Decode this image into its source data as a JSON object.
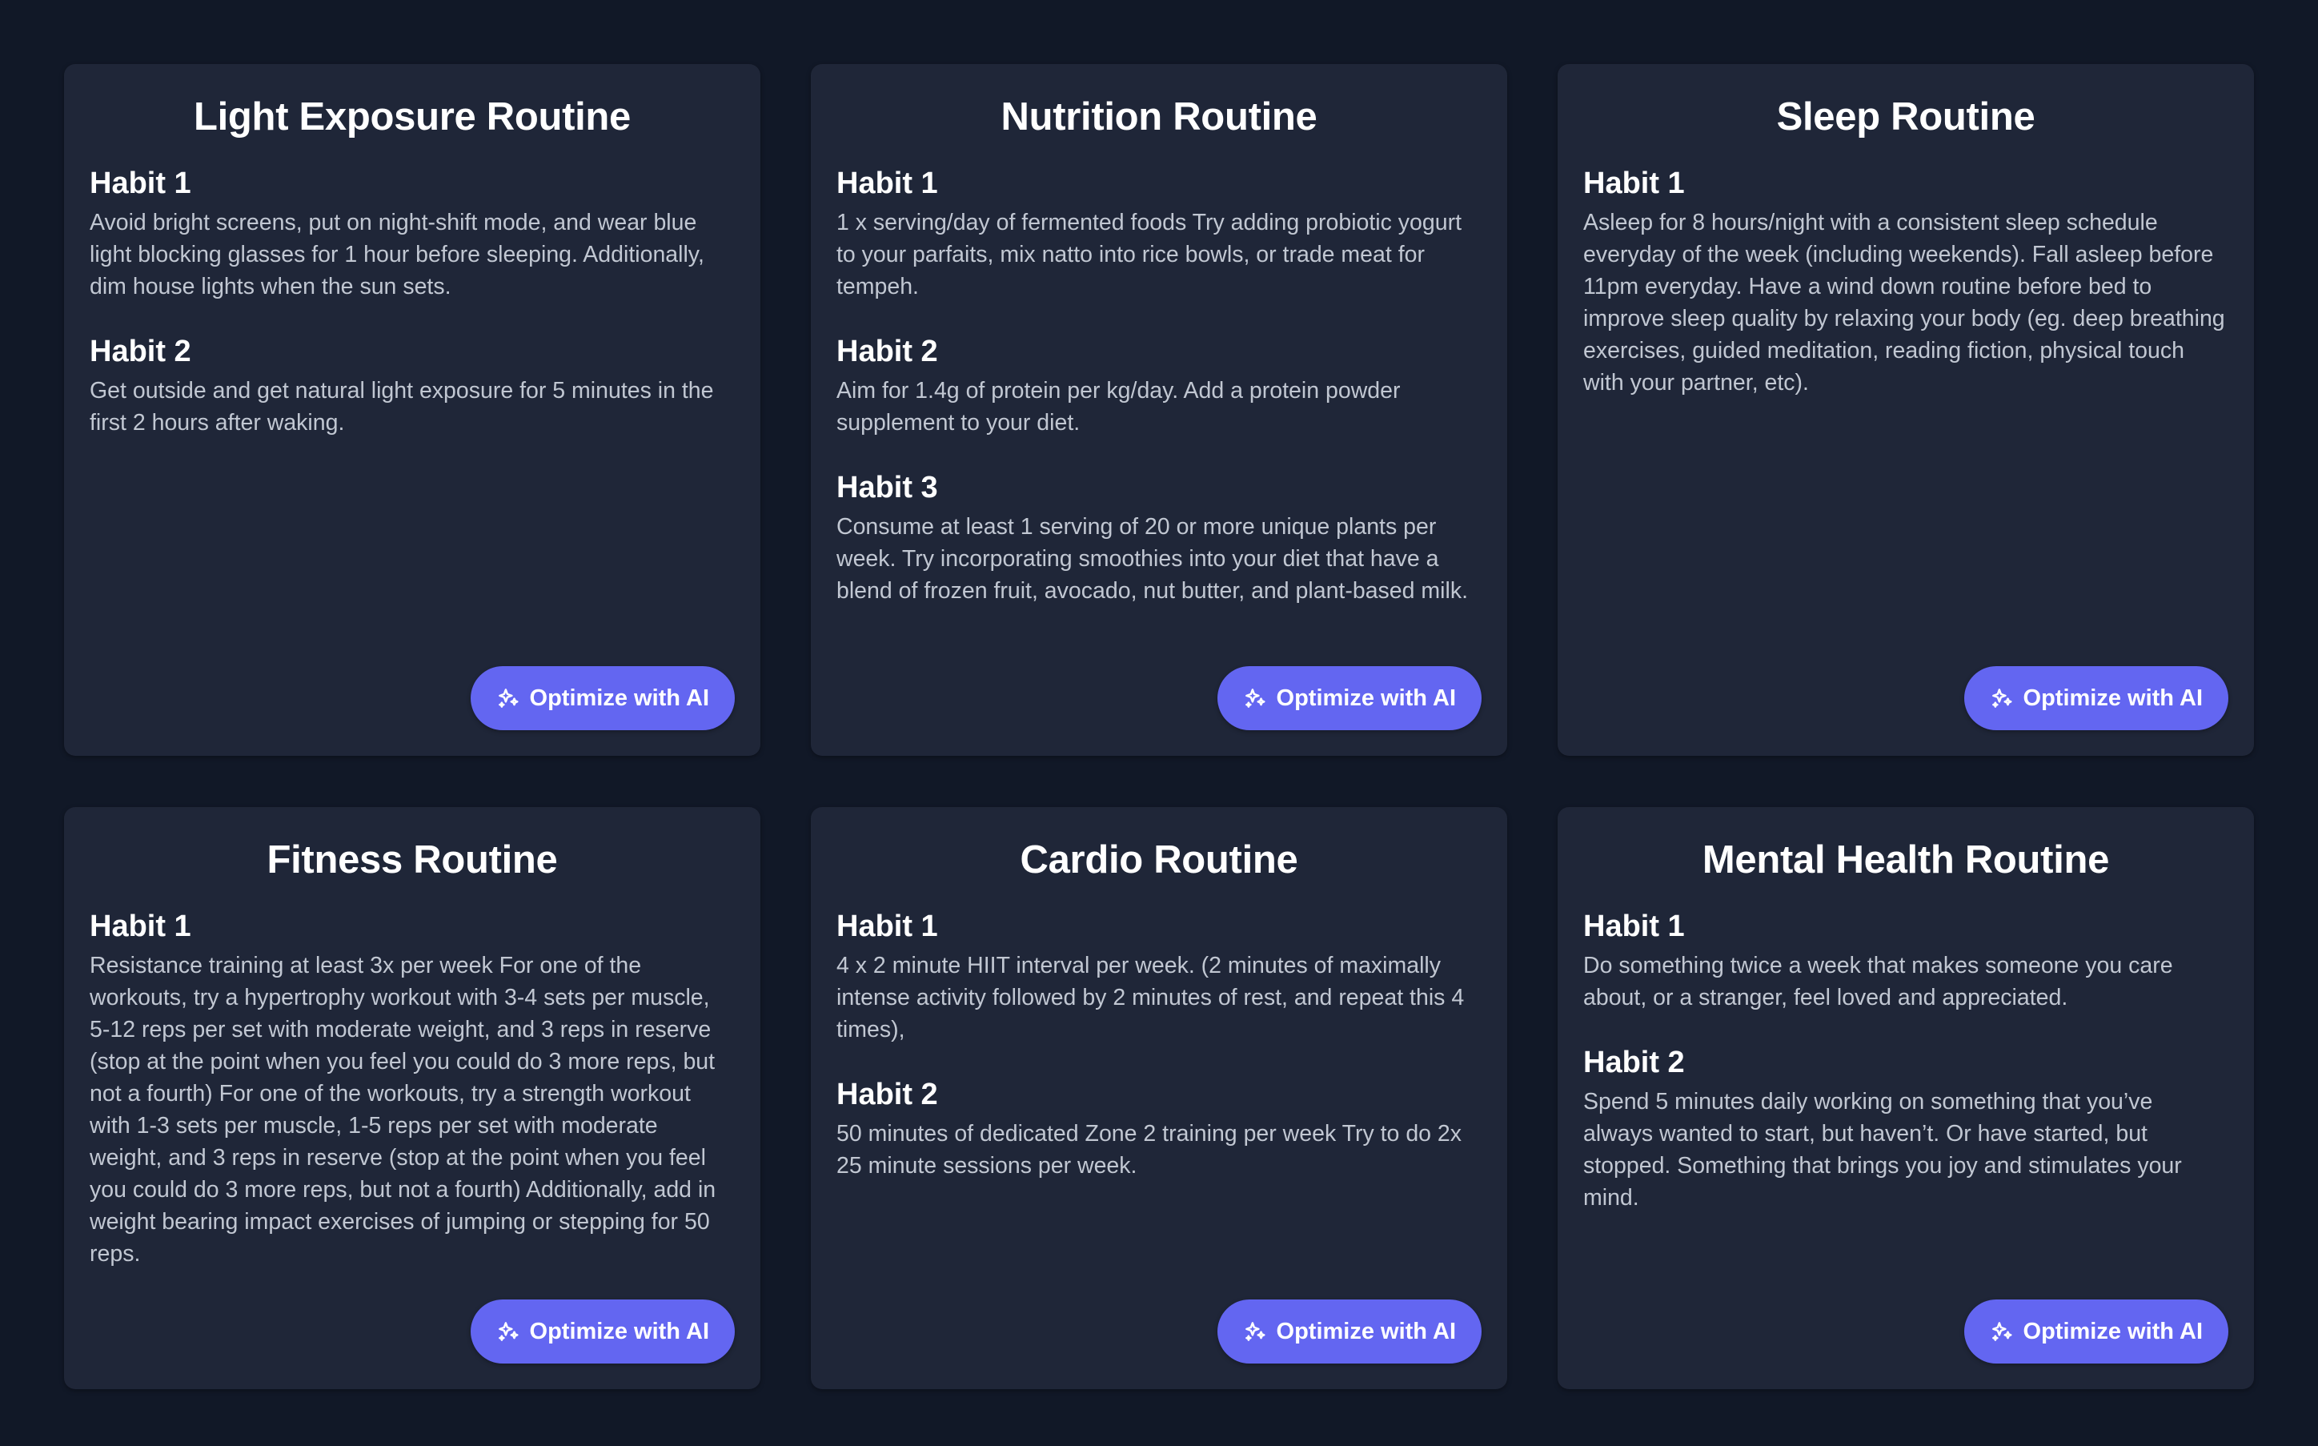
{
  "colors": {
    "background": "#111827",
    "card": "#1f2638",
    "accent": "#6366f1",
    "text_primary": "#ffffff",
    "text_secondary": "#c1c7d2"
  },
  "button_icon": "sparkles-icon",
  "cards": [
    {
      "title": "Light Exposure Routine",
      "habits": [
        {
          "label": "Habit 1",
          "text": "Avoid bright screens, put on night-shift mode, and wear blue light blocking glasses for 1 hour before sleeping. Additionally, dim house lights when the sun sets."
        },
        {
          "label": "Habit 2",
          "text": "Get outside and get natural light exposure for 5 minutes in the first 2 hours after waking."
        }
      ],
      "button": "Optimize with AI"
    },
    {
      "title": "Nutrition Routine",
      "habits": [
        {
          "label": "Habit 1",
          "text": "1 x serving/day of fermented foods Try adding probiotic yogurt to your parfaits, mix natto into rice bowls, or trade meat for tempeh."
        },
        {
          "label": "Habit 2",
          "text": "Aim for 1.4g of protein per kg/day. Add a protein powder supplement to your diet."
        },
        {
          "label": "Habit 3",
          "text": "Consume at least 1 serving of 20 or more unique plants per week. Try incorporating smoothies into your diet that have a blend of frozen fruit, avocado, nut butter, and plant-based milk."
        }
      ],
      "button": "Optimize with AI"
    },
    {
      "title": "Sleep Routine",
      "habits": [
        {
          "label": "Habit 1",
          "text": "Asleep for 8 hours/night with a consistent sleep schedule everyday of the week (including weekends). Fall asleep before 11pm everyday. Have a wind down routine before bed to improve sleep quality by relaxing your body (eg. deep breathing exercises, guided meditation, reading fiction, physical touch with your partner, etc)."
        }
      ],
      "button": "Optimize with AI"
    },
    {
      "title": "Fitness Routine",
      "habits": [
        {
          "label": "Habit 1",
          "text": "Resistance training at least 3x per week For one of the workouts, try a hypertrophy workout with 3-4 sets per muscle, 5-12 reps per set with moderate weight, and 3 reps in reserve (stop at the point when you feel you could do 3 more reps, but not a fourth) For one of the workouts, try a strength workout with 1-3 sets per muscle, 1-5 reps per set with moderate weight, and 3 reps in reserve (stop at the point when you feel you could do 3 more reps, but not a fourth) Additionally, add in weight bearing impact exercises of jumping or stepping for 50 reps."
        }
      ],
      "button": "Optimize with AI"
    },
    {
      "title": "Cardio Routine",
      "habits": [
        {
          "label": "Habit 1",
          "text": "4 x 2 minute HIIT interval per week. (2 minutes of maximally intense activity followed by 2 minutes of rest, and repeat this 4 times),"
        },
        {
          "label": "Habit 2",
          "text": "50 minutes of dedicated Zone 2 training per week Try to do 2x 25 minute sessions per week."
        }
      ],
      "button": "Optimize with AI"
    },
    {
      "title": "Mental Health Routine",
      "habits": [
        {
          "label": "Habit 1",
          "text": "Do something twice a week that makes someone you care about, or a stranger, feel loved and appreciated."
        },
        {
          "label": "Habit 2",
          "text": "Spend 5 minutes daily working on something that you’ve always wanted to start, but haven’t. Or have started, but stopped. Something that brings you joy and stimulates your mind."
        }
      ],
      "button": "Optimize with AI"
    }
  ]
}
